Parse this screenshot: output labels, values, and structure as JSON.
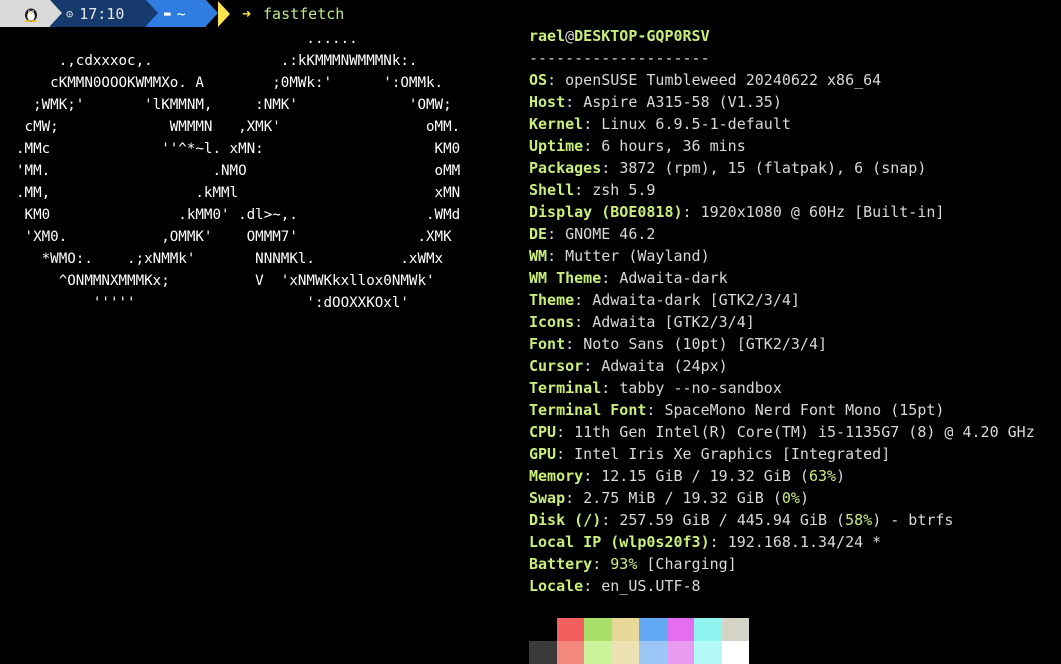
{
  "prompt": {
    "os_icon": "tux-icon",
    "time": "17:10",
    "path": "~",
    "arrow": "➜",
    "command": "fastfetch"
  },
  "logo_lines": [
    "                                  ......",
    "     .,cdxxxoc,.               .:kKMMMNWMMMNk:.",
    "    cKMMN0OOOKWMMXo. A        ;0MWk:'      ':OMMk.",
    "  ;WMK;'       'lKMMNM,     :NMK'             'OMW;",
    " cMW;             WMMMN   ,XMK'                 oMM.",
    ".MMc             ''^*~l. xMN:                    KM0",
    "'MM.                   .NMO                      oMM",
    ".MM,                 .kMMl                       xMN",
    " KM0               .kMM0' .dl>~,.               .WMd",
    " 'XM0.           ,OMMK'    OMMM7'              .XMK",
    "   *WMO:.    .;xNMMk'       NNNMKl.          .xWMx",
    "     ^ONMMNXMMMKx;          V  'xNMWKkxllox0NMWk'",
    "         '''''                    ':dOOXXKOxl'"
  ],
  "info": {
    "user": "rael",
    "at": "@",
    "host": "DESKTOP-GQP0RSV",
    "separator": "--------------------",
    "rows": [
      {
        "key": "OS",
        "value": "openSUSE Tumbleweed 20240622 x86_64"
      },
      {
        "key": "Host",
        "value": "Aspire A315-58 (V1.35)"
      },
      {
        "key": "Kernel",
        "value": "Linux 6.9.5-1-default"
      },
      {
        "key": "Uptime",
        "value": "6 hours, 36 mins"
      },
      {
        "key": "Packages",
        "value": "3872 (rpm), 15 (flatpak), 6 (snap)"
      },
      {
        "key": "Shell",
        "value": "zsh 5.9"
      },
      {
        "key": "Display (BOE0818)",
        "value": "1920x1080 @ 60Hz [Built-in]"
      },
      {
        "key": "DE",
        "value": "GNOME 46.2"
      },
      {
        "key": "WM",
        "value": "Mutter (Wayland)"
      },
      {
        "key": "WM Theme",
        "value": "Adwaita-dark"
      },
      {
        "key": "Theme",
        "value": "Adwaita-dark [GTK2/3/4]"
      },
      {
        "key": "Icons",
        "value": "Adwaita [GTK2/3/4]"
      },
      {
        "key": "Font",
        "value": "Noto Sans (10pt) [GTK2/3/4]"
      },
      {
        "key": "Cursor",
        "value": "Adwaita (24px)"
      },
      {
        "key": "Terminal",
        "value": "tabby --no-sandbox"
      },
      {
        "key": "Terminal Font",
        "value": "SpaceMono Nerd Font Mono (15pt)"
      },
      {
        "key": "CPU",
        "value": "11th Gen Intel(R) Core(TM) i5-1135G7 (8) @ 4.20 GHz"
      },
      {
        "key": "GPU",
        "value": "Intel Iris Xe Graphics [Integrated]"
      }
    ],
    "memory": {
      "key": "Memory",
      "pre": "12.15 GiB / 19.32 GiB (",
      "pct": "63%",
      "post": ")"
    },
    "swap": {
      "key": "Swap",
      "pre": "2.75 MiB / 19.32 GiB (",
      "pct": "0%",
      "post": ")"
    },
    "disk": {
      "key": "Disk (/)",
      "pre": "257.59 GiB / 445.94 GiB (",
      "pct": "58%",
      "post": ") - btrfs"
    },
    "local_ip": {
      "key": "Local IP (wlp0s20f3)",
      "value": "192.168.1.34/24 *"
    },
    "battery": {
      "key": "Battery",
      "pct": "93%",
      "post": " [Charging]"
    },
    "locale": {
      "key": "Locale",
      "value": "en_US.UTF-8"
    }
  },
  "palette": {
    "normal": [
      "#000000",
      "#f25f5c",
      "#a8e06a",
      "#e8d89a",
      "#62a8f2",
      "#e46df0",
      "#8ff3f0",
      "#d4d4c6"
    ],
    "bright": [
      "#3a3a3a",
      "#f3897e",
      "#cdf39a",
      "#ece2b4",
      "#9cc6f6",
      "#e79cf2",
      "#b4fbf8",
      "#ffffff"
    ]
  }
}
